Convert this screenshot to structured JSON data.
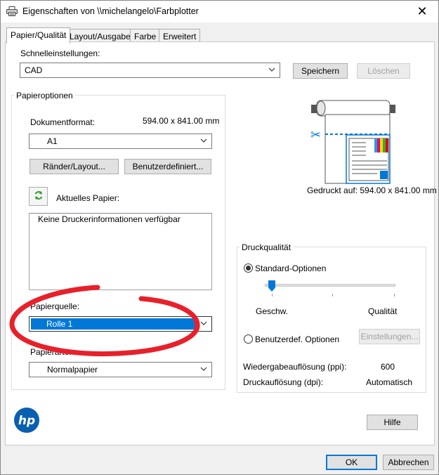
{
  "window": {
    "title": "Eigenschaften von \\\\michelangelo\\Farbplotter",
    "close_symbol": "✕"
  },
  "tabs": [
    {
      "label": "Papier/Qualität",
      "active": true
    },
    {
      "label": "Layout/Ausgabe",
      "active": false
    },
    {
      "label": "Farbe",
      "active": false
    },
    {
      "label": "Erweitert",
      "active": false
    }
  ],
  "quick_settings": {
    "label": "Schnelleinstellungen:",
    "value": "CAD",
    "save_label": "Speichern",
    "delete_label": "Löschen"
  },
  "paper_options": {
    "group_label": "Papieroptionen",
    "doc_format_label": "Dokumentformat:",
    "doc_format_size": "594.00 x 841.00 mm",
    "doc_format_value": "A1",
    "margins_button": "Ränder/Layout...",
    "custom_button": "Benutzerdefiniert...",
    "current_paper_label": "Aktuelles Papier:",
    "printer_info": "Keine Druckerinformationen verfügbar",
    "source_label": "Papierquelle:",
    "source_value": "Rolle 1",
    "type_label": "Papierarte:",
    "type_value": "Normalpapier"
  },
  "preview": {
    "printed_on": "Gedruckt auf: 594.00 x 841.00 mm"
  },
  "print_quality": {
    "group_label": "Druckqualität",
    "standard_option": "Standard-Optionen",
    "speed_label": "Geschw.",
    "quality_label": "Qualität",
    "slider_level": 0,
    "custom_option": "Benutzerdef. Optionen",
    "settings_button": "Einstellungen...",
    "render_res_label": "Wiedergabeauflösung (ppi):",
    "render_res_value": "600",
    "print_res_label": "Druckauflösung (dpi):",
    "print_res_value": "Automatisch"
  },
  "footer": {
    "help_label": "Hilfe",
    "ok_label": "OK",
    "cancel_label": "Abbrechen"
  },
  "colors": {
    "accent": "#0078d7",
    "annotation_circle": "#e8202a"
  },
  "logo": "hp"
}
